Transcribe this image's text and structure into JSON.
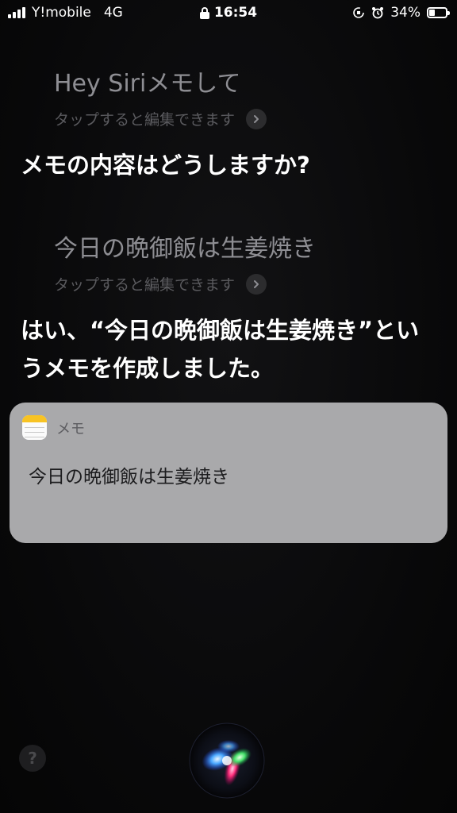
{
  "status_bar": {
    "carrier": "Y!mobile",
    "network": "4G",
    "time": "16:54",
    "battery_percent": "34%",
    "battery_level": 0.34
  },
  "conversation": {
    "utterance_1": {
      "text": "Hey Siriメモして",
      "edit_hint": "タップすると編集できます"
    },
    "response_1": "メモの内容はどうしますか?",
    "utterance_2": {
      "text": "今日の晩御飯は生姜焼き",
      "edit_hint": "タップすると編集できます"
    },
    "response_2": "はい、“今日の晩御飯は生姜焼き”というメモを作成しました。"
  },
  "notes_card": {
    "app_name": "メモ",
    "note_text": "今日の晩御飯は生姜焼き"
  },
  "help_button": {
    "label": "?"
  },
  "colors": {
    "background": "#0b0b0c",
    "card": "#a9a9ab",
    "notes_yellow": "#f8c323"
  }
}
